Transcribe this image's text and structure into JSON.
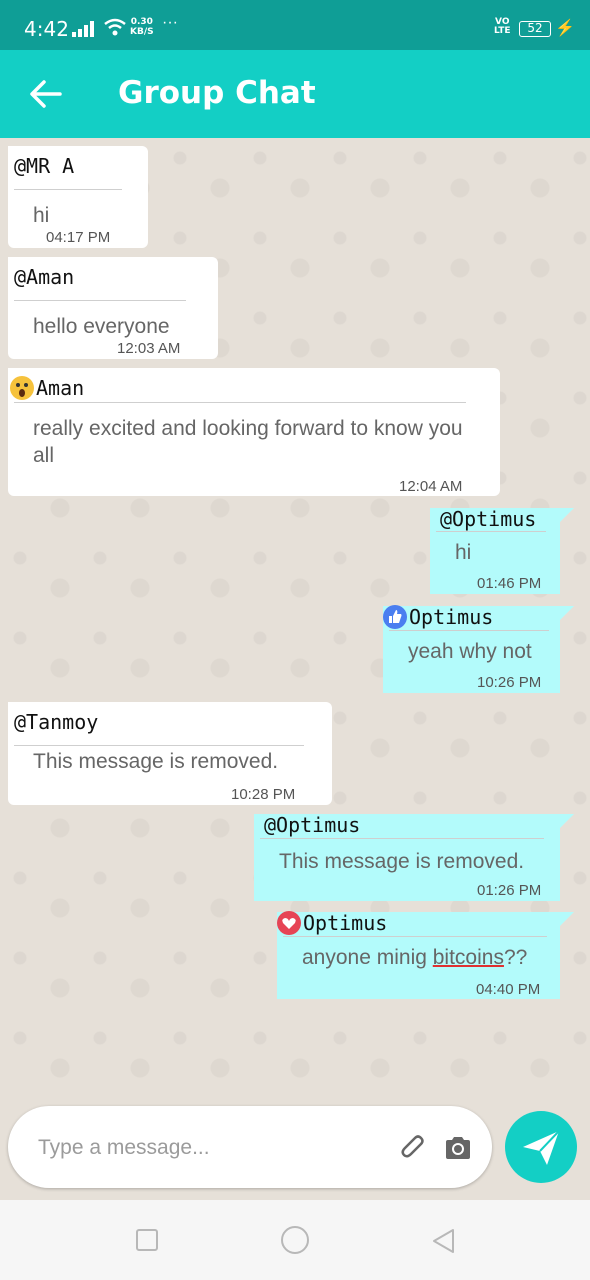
{
  "status_bar": {
    "time": "4:42",
    "speed_value": "0.30",
    "speed_unit": "KB/S",
    "more": "···",
    "volte_top": "VO",
    "volte_bottom": "LTE",
    "battery": "52"
  },
  "header": {
    "title": "Group Chat",
    "back_icon": "arrow-left-icon"
  },
  "messages": [
    {
      "sender": "@MR A",
      "text": "hi",
      "time": "04:17 PM",
      "direction": "incoming"
    },
    {
      "sender": "@Aman",
      "text": "hello everyone",
      "time": "12:03 AM",
      "direction": "incoming"
    },
    {
      "sender": "Aman",
      "reaction": "wow-emoji-icon",
      "text": "really excited and looking forward to know you all",
      "time": "12:04 AM",
      "direction": "incoming"
    },
    {
      "sender": "@Optimus",
      "text": "hi",
      "time": "01:46 PM",
      "direction": "outgoing"
    },
    {
      "sender": "Optimus",
      "reaction": "thumbs-up-icon",
      "text": "yeah why not",
      "time": "10:26 PM",
      "direction": "outgoing"
    },
    {
      "sender": "@Tanmoy",
      "text": "This message is removed.",
      "time": "10:28 PM",
      "direction": "incoming"
    },
    {
      "sender": "@Optimus",
      "text": "This message is removed.",
      "time": "01:26 PM",
      "direction": "outgoing"
    },
    {
      "sender": "Optimus",
      "reaction": "heart-icon",
      "text_before": "anyone minig ",
      "text_misspelled": "bitcoins",
      "text_after": "??",
      "time": "04:40 PM",
      "direction": "outgoing"
    }
  ],
  "composer": {
    "placeholder": "Type a message...",
    "value": ""
  },
  "colors": {
    "status_bar": "#0f9e96",
    "app_bar": "#13cfc5",
    "incoming_bubble": "#ffffff",
    "outgoing_bubble": "#b3fbfb",
    "chat_background": "#e6e0d8"
  }
}
